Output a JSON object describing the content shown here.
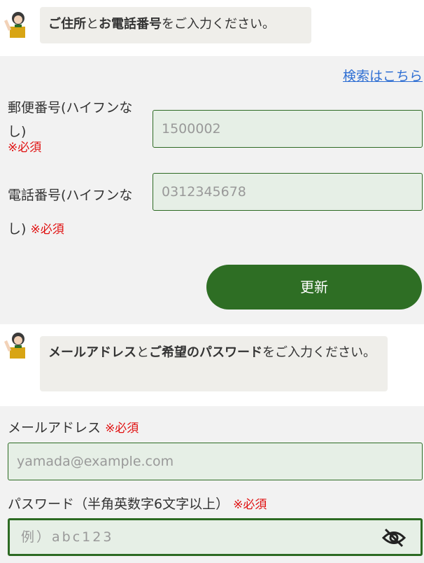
{
  "address_section": {
    "bubble_parts": [
      {
        "text": "ご住所",
        "bold": true
      },
      {
        "text": "と",
        "bold": false
      },
      {
        "text": "お電話番号",
        "bold": true
      },
      {
        "text": "をご入力ください。",
        "bold": false
      }
    ],
    "search_link": "検索はこちら",
    "postal": {
      "label_line1": "郵便番号(ハイフンな",
      "label_line2": "し)",
      "required": "※必須",
      "placeholder": "1500002"
    },
    "phone": {
      "label_line1": "電話番号(ハイフンな",
      "label_line2": "し)",
      "required": "※必須",
      "placeholder": "0312345678"
    },
    "update_button": "更新"
  },
  "account_section": {
    "bubble_parts": [
      {
        "text": "メールアドレス",
        "bold": true
      },
      {
        "text": "と",
        "bold": false
      },
      {
        "text": "ご希望のパスワード",
        "bold": true
      },
      {
        "text": "をご入力ください。",
        "bold": false
      }
    ],
    "email": {
      "label": "メールアドレス",
      "required": "※必須",
      "placeholder": "yamada@example.com"
    },
    "password": {
      "label": "パスワード（半角英数字6文字以上）",
      "required": "※必須",
      "placeholder": "例）abc123",
      "toggle_icon": "eye-slash-icon"
    }
  },
  "colors": {
    "accent_green": "#2e6e24",
    "required_red": "#e01010",
    "link_blue": "#2f6fd3"
  }
}
